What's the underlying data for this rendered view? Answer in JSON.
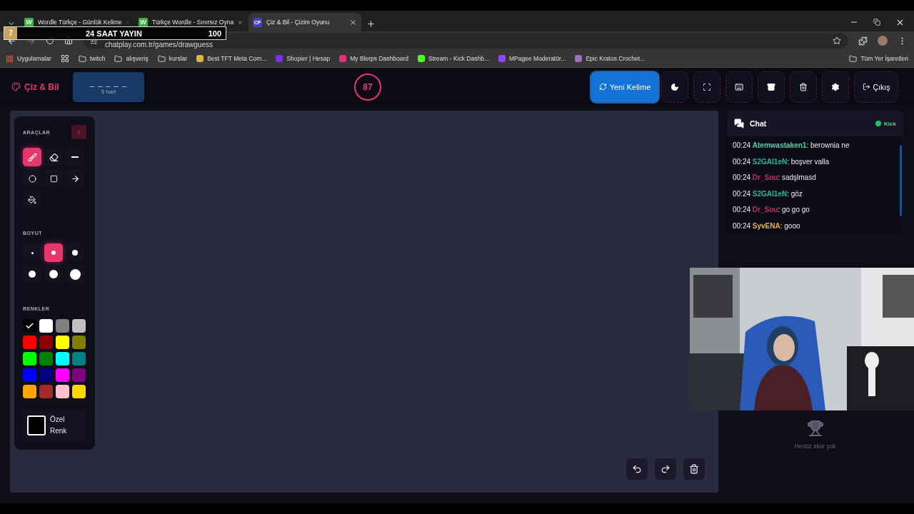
{
  "browser": {
    "tabs": [
      {
        "icon_text": "W",
        "color": "#3fae49",
        "title": "Wordle Türkçe - Günlük Kelime",
        "selected": false
      },
      {
        "icon_text": "W",
        "color": "#3fae49",
        "title": "Türkçe Wordle - Sınırsız Oyna",
        "selected": false
      },
      {
        "icon_text": "CP",
        "color": "#4b3fb0",
        "title": "Çiz & Bil - Çizim Oyunu",
        "selected": true
      }
    ],
    "url": "chatplay.com.tr/games/drawguess",
    "bookmarks": [
      {
        "kind": "apps",
        "label": "Uygulamalar"
      },
      {
        "kind": "grid"
      },
      {
        "kind": "folder",
        "label": "twitch"
      },
      {
        "kind": "folder",
        "label": "alışveriş"
      },
      {
        "kind": "folder",
        "label": "kurslar"
      },
      {
        "kind": "site",
        "color": "#d8b64a",
        "label": "Best TFT Meta Com..."
      },
      {
        "kind": "site",
        "color": "#7b2ff7",
        "label": "Shopier | Hesap"
      },
      {
        "kind": "site",
        "color": "#e0357a",
        "label": "My Blerps Dashboard"
      },
      {
        "kind": "site",
        "color": "#53fc18",
        "label": "Stream - Kick Dashb..."
      },
      {
        "kind": "site",
        "color": "#9146ff",
        "label": "MPagee Moderatör..."
      },
      {
        "kind": "site",
        "color": "#a070c0",
        "label": "Epic Kratos Crochet..."
      }
    ],
    "all_bookmarks": "Tüm Yer İşaretleri"
  },
  "overlay": {
    "badge": "7",
    "title": "24 SAAT YAYIN",
    "count": "100"
  },
  "header": {
    "logo": "Çiz & Bil",
    "word_mask": "_ _ _ _ _",
    "word_hint": "5 harf",
    "timer": "87",
    "new_word": "Yeni Kelime",
    "icon_buttons": [
      {
        "kind": "theme"
      },
      {
        "kind": "fullscreen"
      },
      {
        "kind": "keyboard"
      },
      {
        "kind": "archive"
      },
      {
        "kind": "trash"
      },
      {
        "kind": "settings"
      }
    ],
    "exit": "Çıkış"
  },
  "tools_panel": {
    "tools_heading": "ARAÇLAR",
    "tools": [
      {
        "kind": "brush",
        "selected": true
      },
      {
        "kind": "eraser",
        "selected": false
      },
      {
        "kind": "line",
        "selected": false
      },
      {
        "kind": "circle",
        "selected": false
      },
      {
        "kind": "rect",
        "selected": false
      },
      {
        "kind": "arrow",
        "selected": false
      },
      {
        "kind": "fill",
        "selected": false
      }
    ],
    "size_heading": "BOYUT",
    "sizes": [
      {
        "selected": false
      },
      {
        "selected": true
      },
      {
        "selected": false
      },
      {
        "selected": false
      },
      {
        "selected": false
      },
      {
        "selected": false
      }
    ],
    "colors_heading": "RENKLER",
    "colors": [
      {
        "color": "#000000",
        "selected": true
      },
      {
        "color": "#ffffff",
        "selected": false
      },
      {
        "color": "#808080",
        "selected": false
      },
      {
        "color": "#c0c0c0",
        "selected": false
      },
      {
        "color": "#ff0000",
        "selected": false
      },
      {
        "color": "#8b0000",
        "selected": false
      },
      {
        "color": "#ffff00",
        "selected": false
      },
      {
        "color": "#808000",
        "selected": false
      },
      {
        "color": "#00ff00",
        "selected": false
      },
      {
        "color": "#008000",
        "selected": false
      },
      {
        "color": "#00ffff",
        "selected": false
      },
      {
        "color": "#008080",
        "selected": false
      },
      {
        "color": "#0000ff",
        "selected": false
      },
      {
        "color": "#000080",
        "selected": false
      },
      {
        "color": "#ff00ff",
        "selected": false
      },
      {
        "color": "#800080",
        "selected": false
      },
      {
        "color": "#ffa500",
        "selected": false
      },
      {
        "color": "#a52a2a",
        "selected": false
      },
      {
        "color": "#ffc0cb",
        "selected": false
      },
      {
        "color": "#ffd700",
        "selected": false
      }
    ],
    "custom_color": "Özel Renk"
  },
  "canvas_actions": [
    {
      "kind": "undo"
    },
    {
      "kind": "redo"
    },
    {
      "kind": "clear"
    }
  ],
  "chat": {
    "title": "Chat",
    "source": "Kick",
    "messages": [
      {
        "time": "00:24",
        "user": "Atemwastaken1",
        "color": "#4fd1a5",
        "text": ": berownia ne"
      },
      {
        "time": "00:24",
        "user": "S2GAl1eN",
        "color": "#2bb39a",
        "text": ": boşver valla"
      },
      {
        "time": "00:24",
        "user": "Dr_Sou",
        "color": "#c2305e",
        "text": ": sadşlmasd"
      },
      {
        "time": "00:24",
        "user": "S2GAl1eN",
        "color": "#2bb39a",
        "text": ": göz"
      },
      {
        "time": "00:24",
        "user": "Dr_Sou",
        "color": "#c2305e",
        "text": ": go go go"
      },
      {
        "time": "00:24",
        "user": "SyvENA",
        "color": "#e8b04a",
        "text": ": gooo"
      }
    ]
  },
  "scores": {
    "empty": "Henüz skor yok"
  }
}
